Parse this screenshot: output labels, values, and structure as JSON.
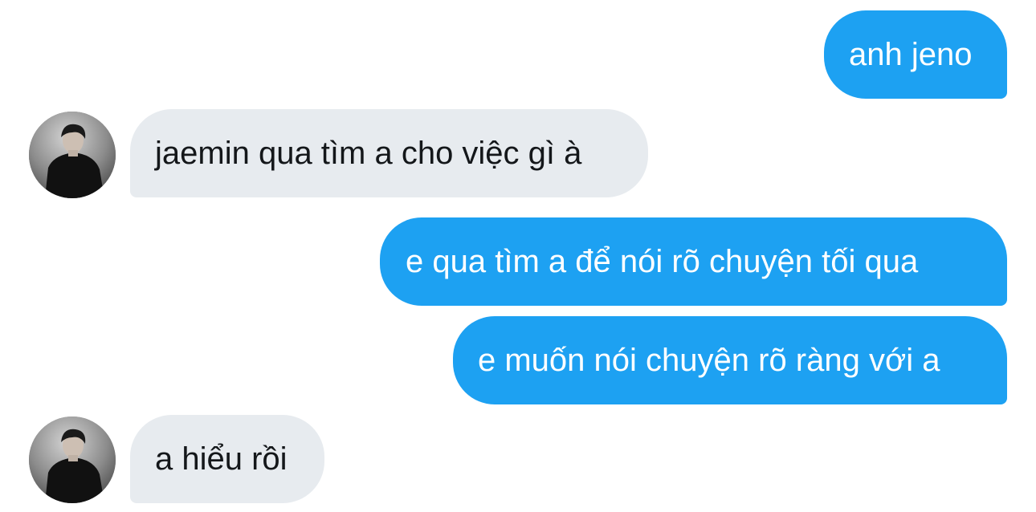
{
  "conversation": {
    "messages": [
      {
        "sender": "me",
        "text": "anh jeno"
      },
      {
        "sender": "other",
        "text": "jaemin qua tìm a cho việc gì à",
        "avatar_icon": "profile-photo-icon"
      },
      {
        "sender": "me",
        "text": "e qua tìm a để nói rõ chuyện tối qua"
      },
      {
        "sender": "me",
        "text": "e muốn nói chuyện rõ ràng với a"
      },
      {
        "sender": "other",
        "text": "a hiểu rồi",
        "avatar_icon": "profile-photo-icon"
      }
    ]
  },
  "colors": {
    "sent_bubble": "#1da1f2",
    "received_bubble": "#e7ebef",
    "sent_text": "#ffffff",
    "received_text": "#14171a"
  }
}
